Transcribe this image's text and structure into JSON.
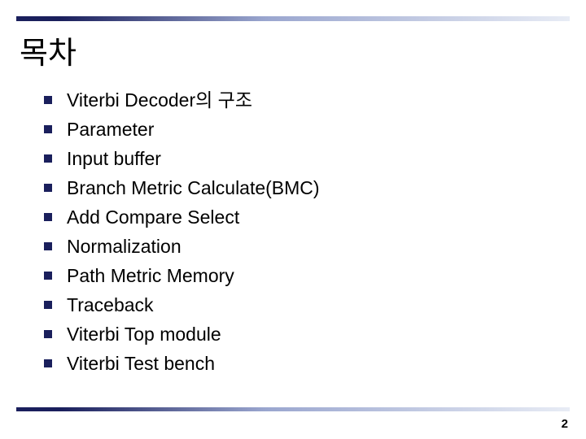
{
  "title": "목차",
  "items": [
    "Viterbi Decoder의 구조",
    "Parameter",
    "Input buffer",
    "Branch Metric Calculate(BMC)",
    "Add Compare Select",
    "Normalization",
    "Path Metric Memory",
    "Traceback",
    "Viterbi Top module",
    "Viterbi Test bench"
  ],
  "page_number": "2"
}
